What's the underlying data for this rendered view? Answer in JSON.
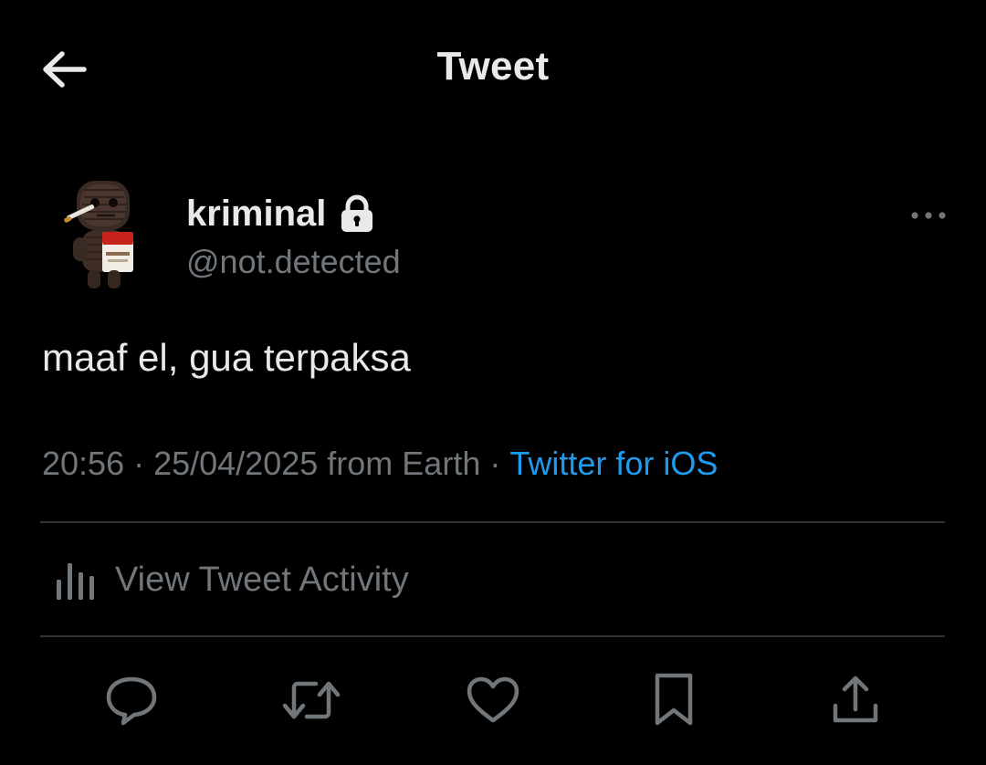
{
  "header": {
    "title": "Tweet",
    "back_icon": "arrow-left-icon"
  },
  "author": {
    "display_name": "kriminal",
    "handle": "@not.detected",
    "protected_icon": "lock-icon",
    "avatar": "knitted-doll-avatar"
  },
  "tweet": {
    "text": "maaf el, gua terpaksa",
    "time": "20:56",
    "date": "25/04/2025",
    "location": "from Earth",
    "source": "Twitter for iOS"
  },
  "activity": {
    "label": "View Tweet Activity",
    "icon": "bar-chart-icon"
  },
  "actions": [
    {
      "name": "reply",
      "icon": "reply-bubble-icon"
    },
    {
      "name": "retweet",
      "icon": "retweet-icon"
    },
    {
      "name": "like",
      "icon": "heart-icon"
    },
    {
      "name": "bookmark",
      "icon": "bookmark-icon"
    },
    {
      "name": "share",
      "icon": "share-icon"
    }
  ],
  "colors": {
    "background": "#000000",
    "text_primary": "#e7e9ea",
    "text_secondary": "#71767b",
    "accent": "#1d9bf0",
    "divider": "#2f3336"
  }
}
